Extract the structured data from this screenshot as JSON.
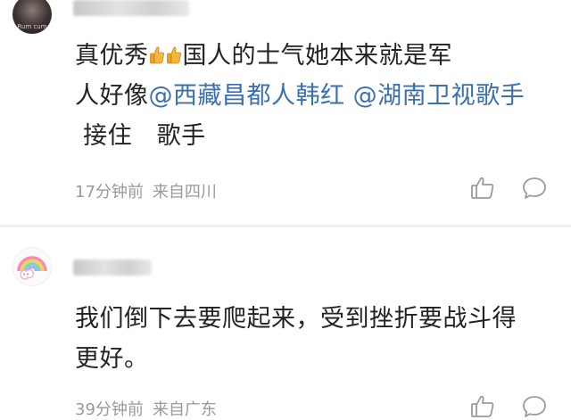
{
  "comments": [
    {
      "avatar_caption": "Rum cum",
      "text_line1_before_emoji": "真优秀",
      "text_line1_after_emoji": "国人的士气她本来就是军",
      "text_line2_prefix": "人好像",
      "mention1": "@西藏昌都人韩红",
      "mention2": "@湖南卫视歌手",
      "text_after_mentions": " 接住　歌手",
      "time": "17分钟前",
      "location": "来自四川",
      "emoji": "thumbs-up-icon"
    },
    {
      "text": "我们倒下去要爬起来，受到挫折要战斗得更好。",
      "time": "39分钟前",
      "location": "来自广东"
    }
  ],
  "icons": {
    "like": "thumbs-up-outline-icon",
    "reply": "speech-bubble-icon"
  },
  "colors": {
    "mention": "#3b6fb0",
    "meta": "#999999",
    "text": "#222222"
  }
}
